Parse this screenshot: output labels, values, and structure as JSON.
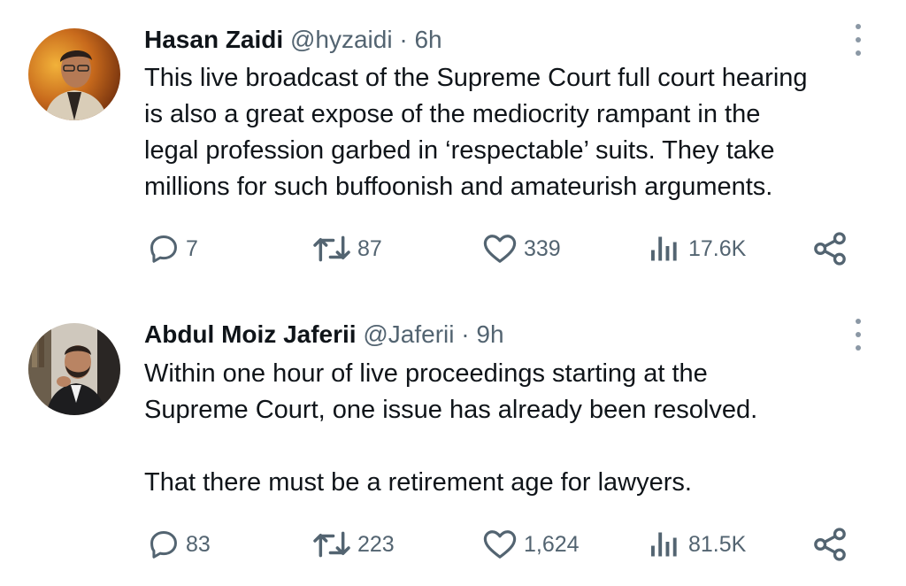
{
  "tweets": [
    {
      "name": "Hasan Zaidi",
      "handle": "@hyzaidi",
      "separator": "·",
      "time": "6h",
      "text": "This live broadcast of the Supreme Court full court hearing\nis also a great expose of the mediocrity rampant in the\nlegal profession garbed in ‘respectable’ suits. They take\nmillions for such buffoonish and amateurish arguments.",
      "replies": "7",
      "retweets": "87",
      "likes": "339",
      "views": "17.6K"
    },
    {
      "name": "Abdul Moiz Jaferii",
      "handle": "@Jaferii",
      "separator": "·",
      "time": "9h",
      "text": "Within one hour of live proceedings starting at the\nSupreme Court, one issue has already been resolved.\n\nThat there must be a retirement age for lawyers.",
      "replies": "83",
      "retweets": "223",
      "likes": "1,624",
      "views": "81.5K"
    }
  ],
  "icons": {
    "reply": "reply-icon",
    "retweet": "retweet-icon",
    "like": "heart-icon",
    "views": "views-icon",
    "share": "share-icon",
    "more": "more-dots-icon"
  },
  "colors": {
    "text": "#0f1419",
    "secondary": "#536471",
    "icon": "#536471",
    "background": "#ffffff"
  }
}
